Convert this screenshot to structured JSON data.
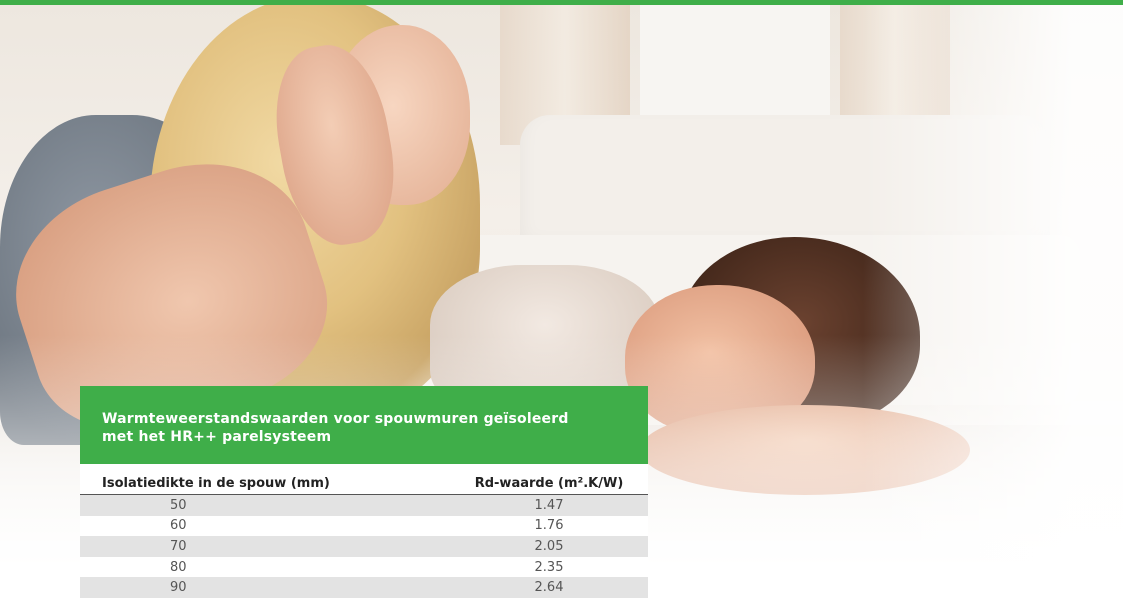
{
  "panel": {
    "title_line1": "Warmteweerstandswaarden voor spouwmuren geïsoleerd",
    "title_line2": "met het HR++ parelsysteem",
    "columns": [
      "Isolatiedikte in de spouw (mm)",
      "Rd-waarde (m².K/W)"
    ],
    "rows": [
      [
        "50",
        "1.47"
      ],
      [
        "60",
        "1.76"
      ],
      [
        "70",
        "2.05"
      ],
      [
        "80",
        "2.35"
      ],
      [
        "90",
        "2.64"
      ]
    ]
  },
  "colors": {
    "accent": "#3fae49"
  }
}
